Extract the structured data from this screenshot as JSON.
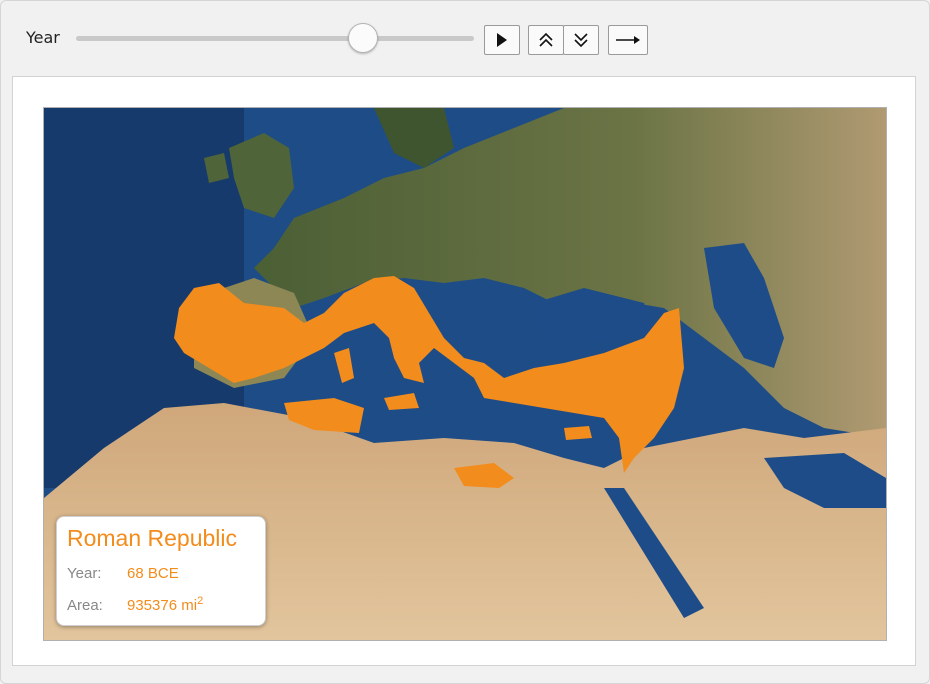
{
  "controls": {
    "slider_label": "Year",
    "slider_position": 0.72,
    "play_icon": "play-icon",
    "faster_icon": "double-chevron-up-icon",
    "slower_icon": "double-chevron-down-icon",
    "direction_icon": "arrow-right-icon"
  },
  "info": {
    "title": "Roman Republic",
    "year_label": "Year:",
    "year_value": "68 BCE",
    "area_label": "Area:",
    "area_value": "935376 mi",
    "area_unit_exp": "2"
  },
  "colors": {
    "territory": "#f28c1c",
    "sea": "#1f4f8a",
    "desert": "#d7b48a",
    "forest": "#5b6b3a"
  }
}
